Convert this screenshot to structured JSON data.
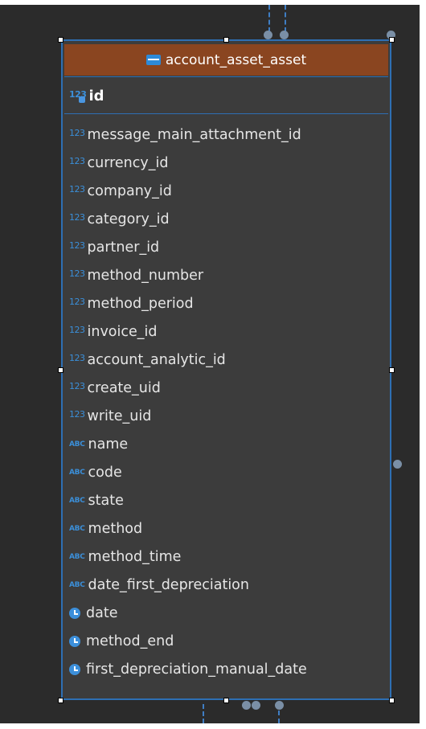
{
  "table": {
    "name": "account_asset_asset",
    "primary_key": {
      "type_icon": "123",
      "name": "id"
    },
    "columns": [
      {
        "type": "number",
        "icon": "123",
        "name": "message_main_attachment_id"
      },
      {
        "type": "number",
        "icon": "123",
        "name": "currency_id"
      },
      {
        "type": "number",
        "icon": "123",
        "name": "company_id"
      },
      {
        "type": "number",
        "icon": "123",
        "name": "category_id"
      },
      {
        "type": "number",
        "icon": "123",
        "name": "partner_id"
      },
      {
        "type": "number",
        "icon": "123",
        "name": "method_number"
      },
      {
        "type": "number",
        "icon": "123",
        "name": "method_period"
      },
      {
        "type": "number",
        "icon": "123",
        "name": "invoice_id"
      },
      {
        "type": "number",
        "icon": "123",
        "name": "account_analytic_id"
      },
      {
        "type": "number",
        "icon": "123",
        "name": "create_uid"
      },
      {
        "type": "number",
        "icon": "123",
        "name": "write_uid"
      },
      {
        "type": "text",
        "icon": "ABC",
        "name": "name"
      },
      {
        "type": "text",
        "icon": "ABC",
        "name": "code"
      },
      {
        "type": "text",
        "icon": "ABC",
        "name": "state"
      },
      {
        "type": "text",
        "icon": "ABC",
        "name": "method"
      },
      {
        "type": "text",
        "icon": "ABC",
        "name": "method_time"
      },
      {
        "type": "text",
        "icon": "ABC",
        "name": "date_first_depreciation"
      },
      {
        "type": "date",
        "icon": "clock-icon",
        "name": "date"
      },
      {
        "type": "date",
        "icon": "clock-icon",
        "name": "method_end"
      },
      {
        "type": "date",
        "icon": "clock-icon",
        "name": "first_depreciation_manual_date"
      }
    ]
  },
  "colors": {
    "header_bg": "#8a4520",
    "selection_border": "#2e6fb3",
    "type_icon": "#3b8fd9",
    "canvas_bg": "#2b2b2b"
  }
}
